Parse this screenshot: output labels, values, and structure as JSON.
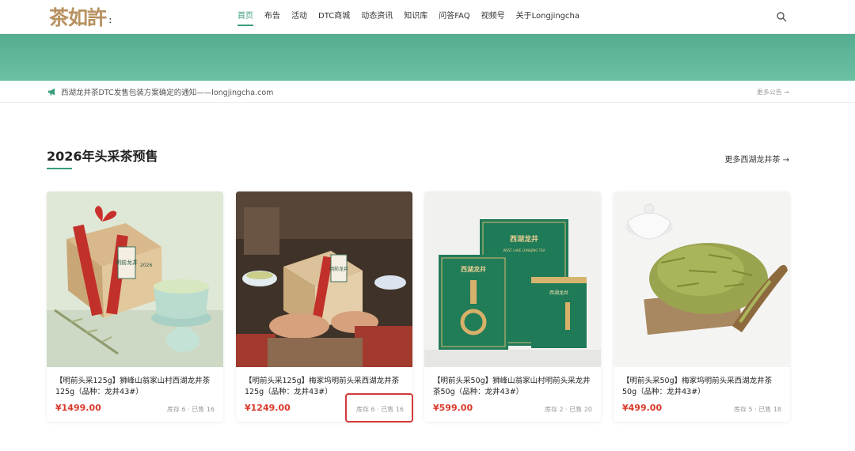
{
  "header": {
    "logo_text": "茶如許",
    "logo_mark": "：",
    "nav": [
      {
        "label": "首页",
        "active": true
      },
      {
        "label": "布告"
      },
      {
        "label": "活动"
      },
      {
        "label": "DTC商城"
      },
      {
        "label": "动态资讯"
      },
      {
        "label": "知识库"
      },
      {
        "label": "问答FAQ"
      },
      {
        "label": "视频号"
      },
      {
        "label": "关于Longjingcha"
      }
    ],
    "search_icon": "search-icon"
  },
  "notice": {
    "icon": "megaphone-icon",
    "text": "西湖龙井茶DTC发售包装方案确定的通知——longjingcha.com",
    "more": "更多公告 →"
  },
  "section": {
    "title": "2026年头采茶预售",
    "more": "更多西湖龙井茶 →"
  },
  "products": [
    {
      "title": "【明前头采125g】狮峰山翁家山村西湖龙井茶125g（品种：龙井43#）",
      "price": "¥1499.00",
      "stock": "库存 6 · 已售 16"
    },
    {
      "title": "【明前头采125g】梅家坞明前头采西湖龙井茶125g（品种：龙井43#）",
      "price": "¥1249.00",
      "stock": "库存 6 · 已售 16"
    },
    {
      "title": "【明前头采50g】狮峰山翁家山村明前头采龙井茶50g（品种：龙井43#）",
      "price": "¥599.00",
      "stock": "库存 2 · 已售 20"
    },
    {
      "title": "【明前头采50g】梅家坞明前头采西湖龙井茶50g（品种：龙井43#）",
      "price": "¥499.00",
      "stock": "库存 5 · 已售 18"
    }
  ],
  "product_images": {
    "p3_box_label": "西湖龙井",
    "p3_box_sub": "WEST LAKE LONGJING TEA",
    "p3_small_label": "西湖龙井",
    "p1_tag": "明前龙井",
    "p1_year": "2026",
    "p2_tag": "明前龙井"
  },
  "colors": {
    "accent": "#3a9c7c",
    "price": "#d93b2b",
    "highlight": "#d63a3a"
  }
}
